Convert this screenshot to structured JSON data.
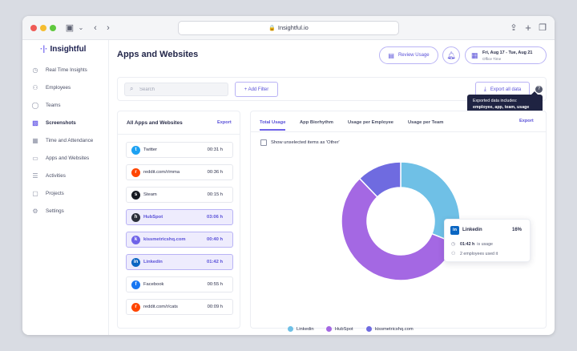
{
  "browser": {
    "url": "Insightful.io"
  },
  "sidebar": {
    "logo": "Insightful",
    "items": [
      {
        "label": "Real Time Insights",
        "icon": "clock-icon"
      },
      {
        "label": "Employees",
        "icon": "users-icon"
      },
      {
        "label": "Teams",
        "icon": "teams-icon"
      },
      {
        "label": "Screenshots",
        "icon": "screenshot-icon"
      },
      {
        "label": "Time and Attendance",
        "icon": "calendar-icon"
      },
      {
        "label": "Apps and Websites",
        "icon": "monitor-icon"
      },
      {
        "label": "Activities",
        "icon": "list-icon"
      },
      {
        "label": "Projects",
        "icon": "briefcase-icon"
      },
      {
        "label": "Settings",
        "icon": "gear-icon"
      }
    ],
    "active_item": "Screenshots"
  },
  "header": {
    "title": "Apps and Websites",
    "review_label": "Review Usage",
    "date_range": "Fri, Aug 17 - Tue, Aug 21",
    "timezone": "Office Time"
  },
  "toolbar": {
    "search_placeholder": "Search",
    "filter_label": "+ Add Filter",
    "export_all_label": "Export all data"
  },
  "tooltip": {
    "line1": "Exported data includes:",
    "line2": "employee, app, team, usage"
  },
  "apps_panel": {
    "title": "All Apps and Websites",
    "export_label": "Export",
    "rows": [
      {
        "name": "Twitter",
        "time": "00:31 h",
        "selected": false,
        "color": "#1da1f2",
        "glyph": "t"
      },
      {
        "name": "reddit.com/r/mma",
        "time": "00:36 h",
        "selected": false,
        "color": "#ff4500",
        "glyph": "r"
      },
      {
        "name": "Steam",
        "time": "00:15 h",
        "selected": false,
        "color": "#171a21",
        "glyph": "s"
      },
      {
        "name": "HubSpot",
        "time": "03:06 h",
        "selected": true,
        "color": "#2b2f3a",
        "glyph": "h"
      },
      {
        "name": "kissmetricshq.com",
        "time": "00:40 h",
        "selected": true,
        "color": "#6f63e8",
        "glyph": "k"
      },
      {
        "name": "Linkedin",
        "time": "01:42 h",
        "selected": true,
        "color": "#0a66c2",
        "glyph": "in"
      },
      {
        "name": "Facebook",
        "time": "00:55 h",
        "selected": false,
        "color": "#1877f2",
        "glyph": "f"
      },
      {
        "name": "reddit.com/r/cats",
        "time": "00:09 h",
        "selected": false,
        "color": "#ff4500",
        "glyph": "r"
      }
    ]
  },
  "chart_panel": {
    "tabs": [
      "Total Usage",
      "App Biorhythm",
      "Usage per Employee",
      "Usage per Team"
    ],
    "active_tab": "Total Usage",
    "export_label": "Export",
    "checkbox_label": "Show unselected items as 'Other'",
    "tip": {
      "name": "Linkedin",
      "percent": "16%",
      "usage_value": "01:42 h",
      "usage_suffix": "is usage",
      "employees": "2 employees used it"
    }
  },
  "chart_data": {
    "type": "pie",
    "donut": true,
    "series": [
      {
        "name": "Linkedin",
        "value": 102,
        "color": "#6fc0e6"
      },
      {
        "name": "HubSpot",
        "value": 186,
        "color": "#a468e3"
      },
      {
        "name": "kissmetricshq.com",
        "value": 40,
        "color": "#6f6be0"
      }
    ],
    "legend": [
      "Linkedin",
      "HubSpot",
      "kissmetricshq.com"
    ],
    "legend_position": "bottom",
    "title": ""
  }
}
